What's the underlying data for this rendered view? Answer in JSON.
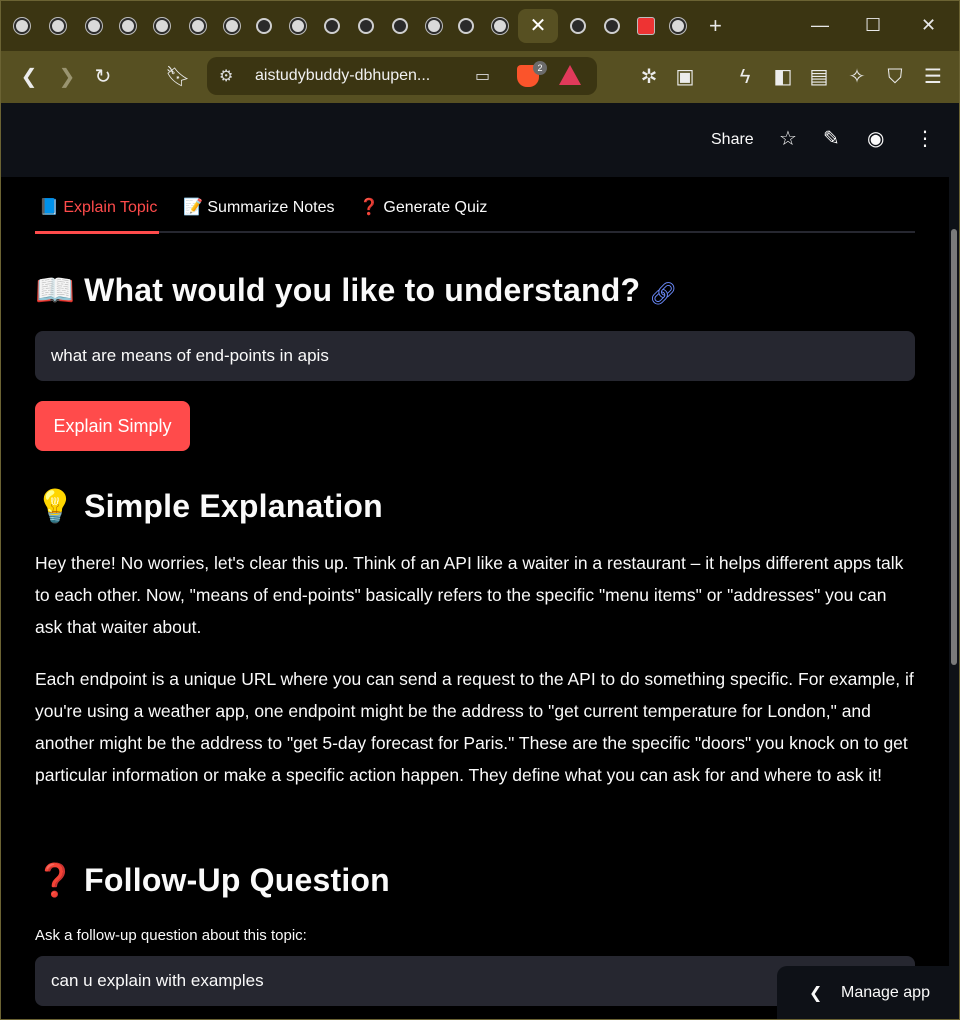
{
  "browser": {
    "active_tab_close": "✕",
    "new_tab": "+",
    "address": "aistudybuddy-dbhupen...",
    "brave_badge": "2",
    "window": {
      "minimize": "—",
      "maximize": "☐",
      "close": "✕"
    }
  },
  "app_header": {
    "share_label": "Share"
  },
  "tabs": [
    {
      "icon": "📘",
      "label": "Explain Topic"
    },
    {
      "icon": "📝",
      "label": "Summarize Notes"
    },
    {
      "icon": "❓",
      "label": "Generate Quiz"
    }
  ],
  "section1": {
    "icon": "📖",
    "title": "What would you like to understand?"
  },
  "topic_input": {
    "value": "what are means of end-points in apis"
  },
  "explain_button": {
    "label": "Explain Simply"
  },
  "section2": {
    "icon": "💡",
    "title": "Simple Explanation"
  },
  "explanation": {
    "p1": "Hey there! No worries, let's clear this up. Think of an API like a waiter in a restaurant – it helps different apps talk to each other. Now, \"means of end-points\" basically refers to the specific \"menu items\" or \"addresses\" you can ask that waiter about.",
    "p2": "Each endpoint is a unique URL where you can send a request to the API to do something specific. For example, if you're using a weather app, one endpoint might be the address to \"get current temperature for London,\" and another might be the address to \"get 5-day forecast for Paris.\" These are the specific \"doors\" you knock on to get particular information or make a specific action happen. They define what you can ask for and where to ask it!"
  },
  "section3": {
    "icon": "❓",
    "title": "Follow-Up Question"
  },
  "followup": {
    "label": "Ask a follow-up question about this topic:",
    "value": "can u explain with examples"
  },
  "manage_app": {
    "label": "Manage app"
  },
  "colors": {
    "accent": "#ff4b4b",
    "background": "#000000",
    "input_bg": "#262730",
    "link": "#6c8cff",
    "browser_chrome": "#575022"
  }
}
